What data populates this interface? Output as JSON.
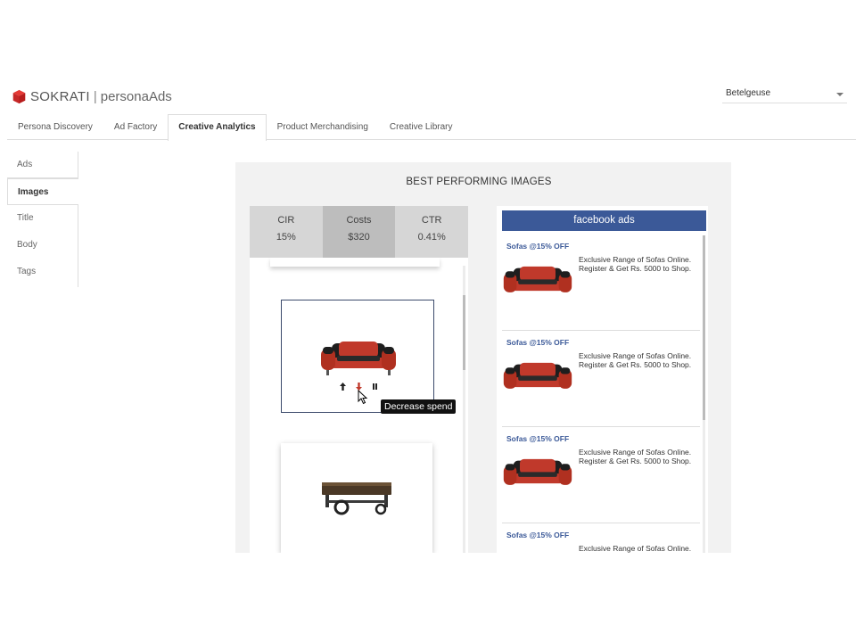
{
  "header": {
    "brand": "SOKRATI",
    "separator": "|",
    "product": "personaAds",
    "account": "Betelgeuse"
  },
  "tabs": [
    {
      "label": "Persona Discovery"
    },
    {
      "label": "Ad Factory"
    },
    {
      "label": "Creative Analytics",
      "active": true
    },
    {
      "label": "Product Merchandising"
    },
    {
      "label": "Creative Library"
    }
  ],
  "sidebar": {
    "items": [
      {
        "label": "Ads"
      },
      {
        "label": "Images",
        "active": true
      },
      {
        "label": "Title"
      },
      {
        "label": "Body"
      },
      {
        "label": "Tags"
      }
    ]
  },
  "panel": {
    "title": "BEST PERFORMING IMAGES",
    "metrics": [
      {
        "label": "CIR",
        "value": "15%"
      },
      {
        "label": "Costs",
        "value": "$320",
        "active": true
      },
      {
        "label": "CTR",
        "value": "0.41%"
      }
    ],
    "tooltip": "Decrease spend",
    "controls": {
      "up": "increase-spend",
      "down": "decrease-spend",
      "pause": "pause"
    }
  },
  "facebook": {
    "header": "facebook ads",
    "ads": [
      {
        "title": "Sofas @15% OFF",
        "text": "Exclusive Range of Sofas Online. Register & Get Rs. 5000 to Shop."
      },
      {
        "title": "Sofas @15% OFF",
        "text": "Exclusive Range of Sofas Online. Register & Get Rs. 5000 to Shop."
      },
      {
        "title": "Sofas @15% OFF",
        "text": "Exclusive Range of Sofas Online. Register & Get Rs. 5000 to Shop."
      },
      {
        "title": "Sofas @15% OFF",
        "text": "Exclusive Range of Sofas Online."
      }
    ]
  },
  "colors": {
    "facebook_blue": "#3b5998",
    "logo_red": "#d32f2f",
    "selected_border": "#3b4a6b"
  }
}
